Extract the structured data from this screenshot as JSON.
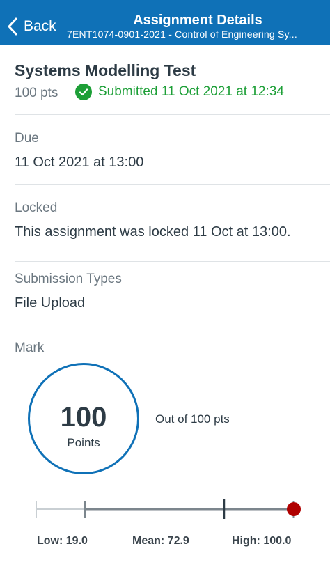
{
  "nav": {
    "back_label": "Back",
    "title": "Assignment Details",
    "subtitle": "7ENT1074-0901-2021 - Control of Engineering Sy..."
  },
  "assignment": {
    "name": "Systems Modelling Test",
    "points": "100 pts",
    "status": "Submitted 11 Oct 2021 at 12:34"
  },
  "due": {
    "label": "Due",
    "value": "11 Oct 2021 at 13:00"
  },
  "locked": {
    "label": "Locked",
    "value": "This assignment was locked 11 Oct at 13:00."
  },
  "submission_types": {
    "label": "Submission Types",
    "value": "File Upload"
  },
  "mark": {
    "label": "Mark",
    "score": "100",
    "score_label": "Points",
    "out_of": "Out of 100 pts"
  },
  "stats": {
    "low_label": "Low: 19.0",
    "mean_label": "Mean: 72.9",
    "high_label": "High: 100.0",
    "low": 19.0,
    "mean": 72.9,
    "high": 100.0,
    "max": 100,
    "your_score": 100
  },
  "colors": {
    "brand": "#0f71b7",
    "success": "#1d9f37",
    "score_marker": "#b00000"
  }
}
